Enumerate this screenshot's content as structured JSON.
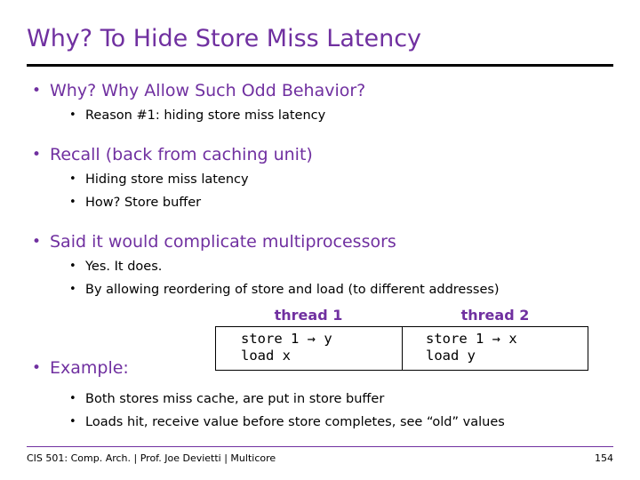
{
  "slide": {
    "title": "Why? To Hide Store Miss Latency",
    "bullets": [
      {
        "level": 1,
        "text": "Why?  Why Allow Such Odd Behavior?"
      },
      {
        "level": 2,
        "text": "Reason #1: hiding store miss latency"
      },
      {
        "level": 1,
        "text": "Recall (back from caching unit)"
      },
      {
        "level": 2,
        "text": "Hiding store miss latency"
      },
      {
        "level": 2,
        "text": "How?  Store buffer"
      },
      {
        "level": 1,
        "text": "Said it would complicate multiprocessors"
      },
      {
        "level": 2,
        "text": "Yes.   It does."
      },
      {
        "level": 2,
        "text": "By allowing reordering of store and load (to different addresses)"
      }
    ],
    "example_label": "Example:",
    "bullet_glyph": "•",
    "thread_table": {
      "headers": [
        "thread 1",
        "thread 2"
      ],
      "columns": [
        [
          "store 1 → y",
          "load x"
        ],
        [
          "store 1 → x",
          "load y"
        ]
      ]
    },
    "bottom_bullets": [
      {
        "level": 2,
        "text": "Both stores miss cache, are put in store buffer"
      },
      {
        "level": 2,
        "text": "Loads hit, receive value before store completes, see “old” values"
      }
    ],
    "footer_left": "CIS 501: Comp. Arch.  |  Prof. Joe Devietti  |  Multicore",
    "footer_right": "154",
    "accent_color": "#7030a0"
  }
}
